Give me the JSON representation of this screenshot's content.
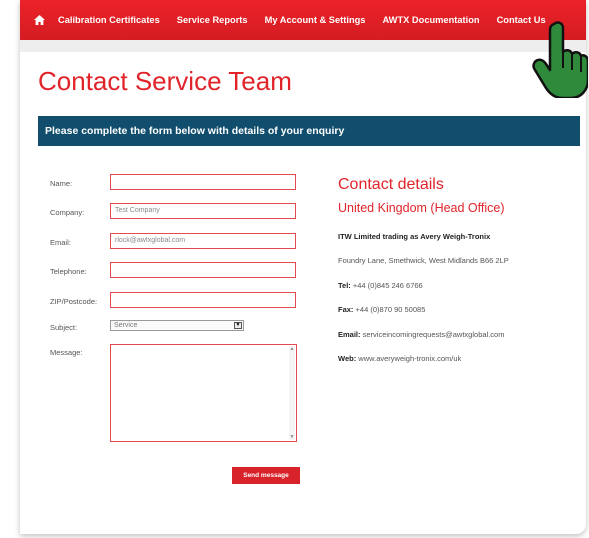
{
  "nav": {
    "items": [
      "Calibration Certificates",
      "Service Reports",
      "My Account & Settings",
      "AWTX Documentation",
      "Contact Us"
    ]
  },
  "page": {
    "title": "Contact Service Team",
    "banner": "Please complete the form below with details of your enquiry"
  },
  "form": {
    "name_label": "Name:",
    "name_value": "",
    "company_label": "Company:",
    "company_value": "Test Company",
    "email_label": "Email:",
    "email_value": "rlock@awtxglobal.com",
    "telephone_label": "Telephone:",
    "telephone_value": "",
    "zip_label": "ZIP/Postcode:",
    "zip_value": "",
    "subject_label": "Subject:",
    "subject_value": "Service",
    "message_label": "Message:",
    "send_label": "Send message"
  },
  "contact": {
    "title": "Contact details",
    "region": "United Kingdom (Head Office)",
    "company": "ITW Limited trading as Avery Weigh-Tronix",
    "address": "Foundry Lane, Smethwick, West Midlands B66 2LP",
    "tel_label": "Tel:",
    "tel_value": "+44 (0)845 246 6766",
    "fax_label": "Fax:",
    "fax_value": "+44 (0)870 90 50085",
    "email_label": "Email:",
    "email_value": "serviceincomingrequests@awtxglobal.com",
    "web_label": "Web:",
    "web_value": "www.averyweigh-tronix.com/uk"
  },
  "colors": {
    "brand_red": "#e32027",
    "banner_blue": "#114e6e"
  },
  "icons": {
    "home": "home-icon",
    "cursor": "hand-pointer-icon"
  }
}
